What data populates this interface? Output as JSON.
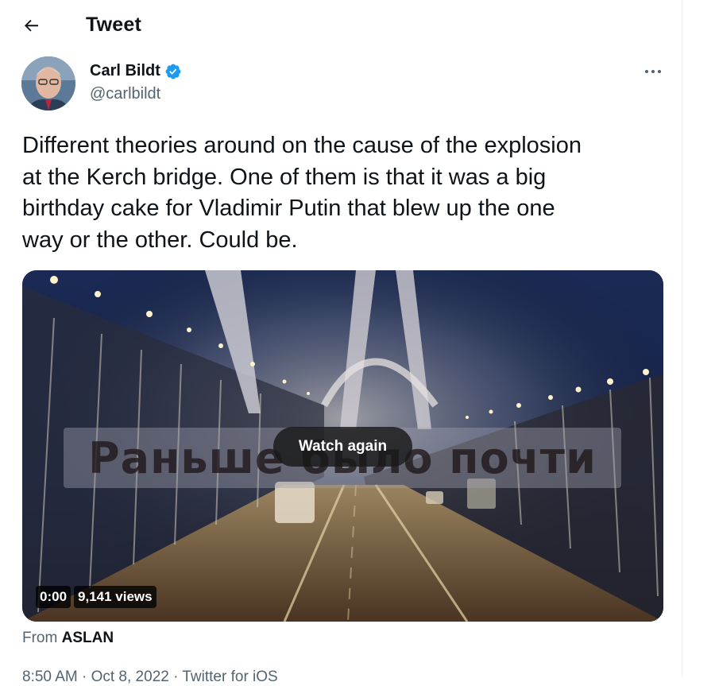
{
  "header": {
    "title": "Tweet"
  },
  "author": {
    "name": "Carl Bildt",
    "handle": "@carlbildt",
    "verified": true
  },
  "tweet": {
    "text": "Different theories around on the cause of the explosion\nat the Kerch bridge. One of them is that it was a big\nbirthday cake for Vladimir Putin that blew up the one\nway or the other. Could be."
  },
  "video": {
    "caption_overlay": "Раньше было почти",
    "watch_again_label": "Watch again",
    "time": "0:00",
    "views": "9,141 views"
  },
  "source": {
    "prefix": "From",
    "name": "ASLAN"
  },
  "meta_partial": "8:50 AM · Oct 8, 2022 · Twitter for iOS",
  "colors": {
    "accent": "#1d9bf0",
    "secondary_text": "#536471",
    "primary_text": "#0f1419"
  },
  "icons": {
    "back": "arrow-left-icon",
    "verified": "verified-badge-icon",
    "more": "more-horizontal-icon"
  }
}
